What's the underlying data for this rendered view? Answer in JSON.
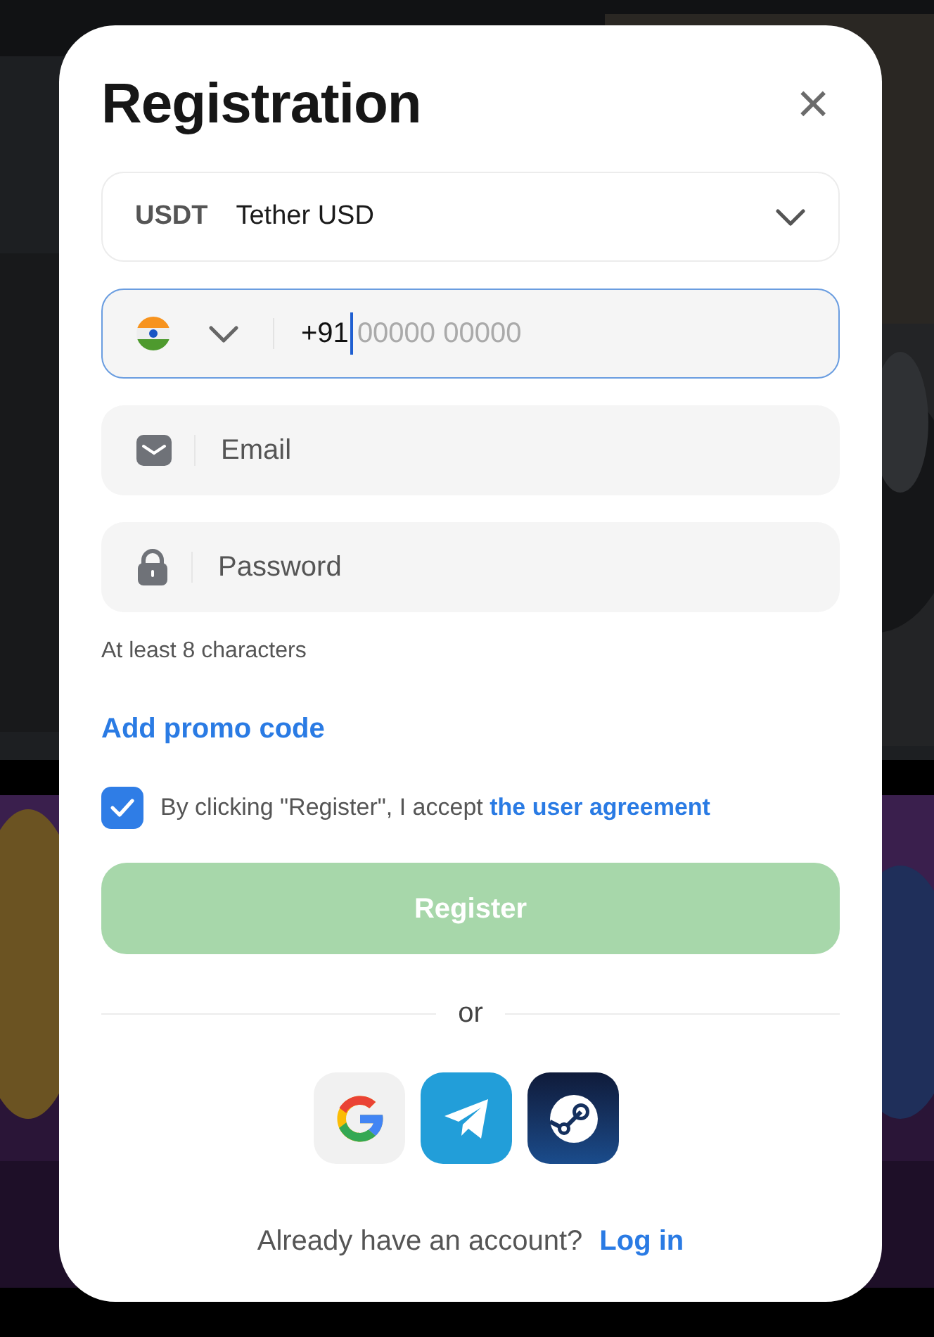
{
  "dialog": {
    "title": "Registration",
    "close": "×"
  },
  "currency": {
    "code": "USDT",
    "name": "Tether USD"
  },
  "phone": {
    "value": "+91",
    "placeholder": "00000 00000",
    "focused": true
  },
  "email": {
    "placeholder": "Email",
    "focused": false
  },
  "password": {
    "placeholder": "Password",
    "focused": false,
    "hint": "At least 8 characters"
  },
  "promo_link": "Add promo code",
  "agreement": {
    "checked": true,
    "text": "By clicking \"Register\", I accept",
    "link": "the user agreement"
  },
  "register_button": {
    "label": "Register",
    "disabled": true
  },
  "divider": "or",
  "social": [
    {
      "kind": "google"
    },
    {
      "kind": "telegram"
    },
    {
      "kind": "steam"
    }
  ],
  "footer": {
    "text": "Already have an account?",
    "link": "Log in"
  }
}
